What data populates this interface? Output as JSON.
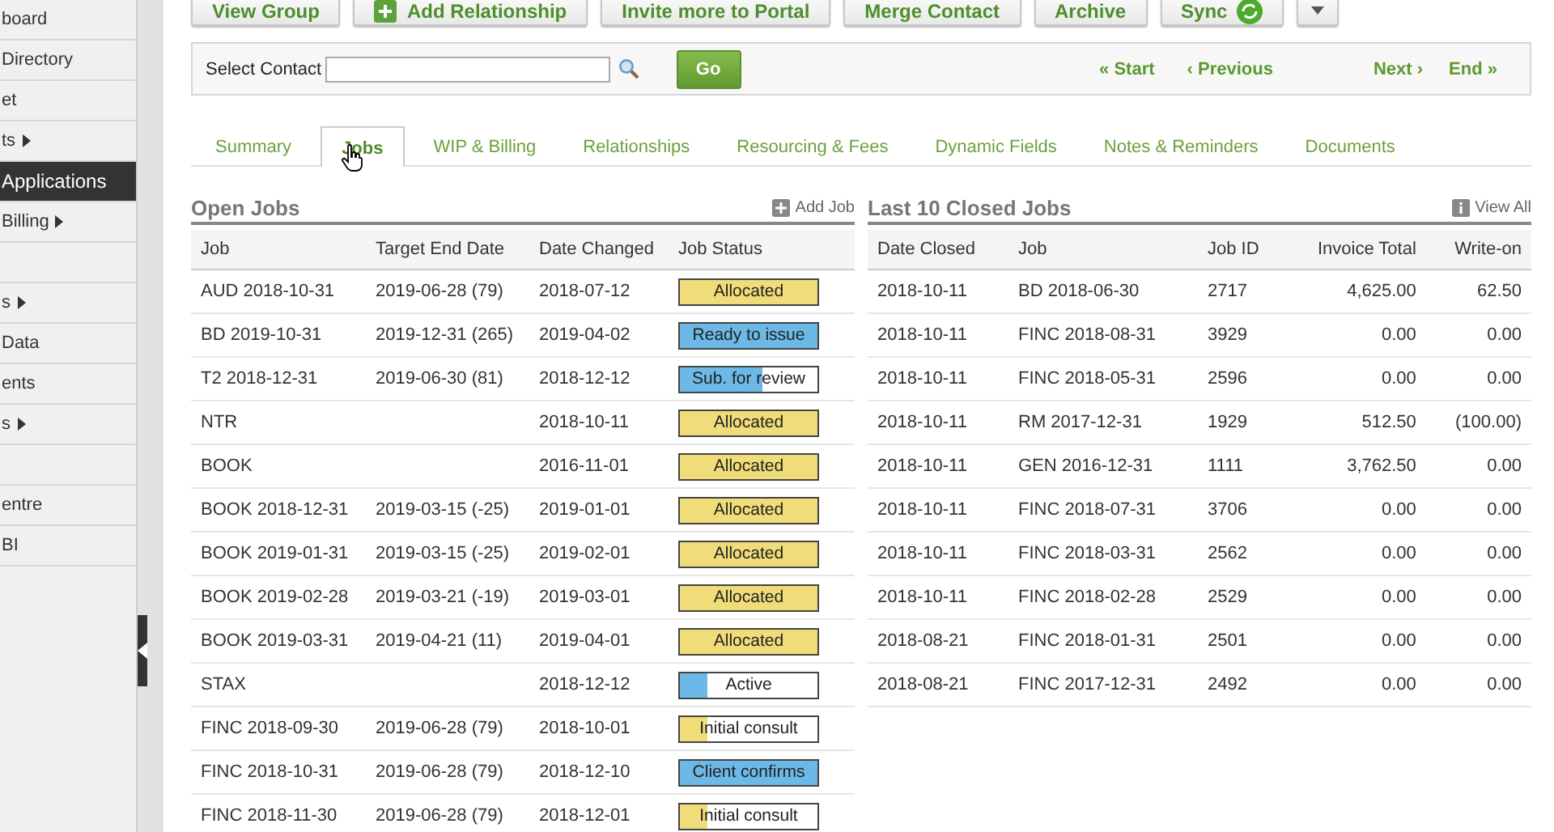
{
  "sidebar": {
    "items": [
      {
        "kind": "link",
        "label": "board",
        "selected": false,
        "submenu": false
      },
      {
        "kind": "link",
        "label": "Directory",
        "selected": false,
        "submenu": false
      },
      {
        "kind": "link",
        "label": "et",
        "selected": false,
        "submenu": false
      },
      {
        "kind": "link",
        "label": "ts",
        "selected": false,
        "submenu": true
      },
      {
        "kind": "link",
        "label": "Applications",
        "selected": true,
        "submenu": false
      },
      {
        "kind": "link",
        "label": "Billing",
        "selected": false,
        "submenu": true
      },
      {
        "kind": "blank"
      },
      {
        "kind": "link",
        "label": "s",
        "selected": false,
        "submenu": true
      },
      {
        "kind": "link",
        "label": "Data",
        "selected": false,
        "submenu": false
      },
      {
        "kind": "link",
        "label": "ents",
        "selected": false,
        "submenu": false
      },
      {
        "kind": "link",
        "label": "s",
        "selected": false,
        "submenu": true
      },
      {
        "kind": "blank"
      },
      {
        "kind": "link",
        "label": "entre",
        "selected": false,
        "submenu": false
      },
      {
        "kind": "link",
        "label": "BI",
        "selected": false,
        "submenu": false
      }
    ]
  },
  "toolbar": [
    {
      "kind": "plain",
      "label": "View Group"
    },
    {
      "kind": "add",
      "label": "Add Relationship"
    },
    {
      "kind": "plain",
      "label": "Invite more to Portal"
    },
    {
      "kind": "plain",
      "label": "Merge Contact"
    },
    {
      "kind": "plain",
      "label": "Archive"
    },
    {
      "kind": "sync",
      "label": "Sync"
    },
    {
      "kind": "menu"
    }
  ],
  "contact_bar": {
    "label": "Select Contact",
    "go": "Go",
    "nav": [
      "« Start",
      "‹ Previous",
      "Next ›",
      "End »"
    ]
  },
  "tabs": [
    {
      "label": "Summary",
      "selected": false
    },
    {
      "label": "Jobs",
      "selected": true
    },
    {
      "label": "WIP & Billing",
      "selected": false
    },
    {
      "label": "Relationships",
      "selected": false
    },
    {
      "label": "Resourcing & Fees",
      "selected": false
    },
    {
      "label": "Dynamic Fields",
      "selected": false
    },
    {
      "label": "Notes & Reminders",
      "selected": false
    },
    {
      "label": "Documents",
      "selected": false
    }
  ],
  "open_jobs": {
    "title": "Open Jobs",
    "action": "Add Job",
    "columns": [
      "Job",
      "Target End Date",
      "Date Changed",
      "Job Status"
    ],
    "rows": [
      {
        "job": "AUD 2018-10-31",
        "target": "2019-06-28 (79)",
        "changed": "2018-07-12",
        "status": {
          "label": "Allocated",
          "color": "#f0dc78",
          "level": 1
        }
      },
      {
        "job": "BD 2019-10-31",
        "target": "2019-12-31 (265)",
        "changed": "2019-04-02",
        "status": {
          "label": "Ready to issue",
          "color": "#6cb8e6",
          "level": 1
        }
      },
      {
        "job": "T2 2018-12-31",
        "target": "2019-06-30 (81)",
        "changed": "2018-12-12",
        "status": {
          "label": "Sub. for review",
          "color": "#6cb8e6",
          "level": 0.6
        }
      },
      {
        "job": "NTR",
        "changed": "2018-10-11",
        "status": {
          "label": "Allocated",
          "color": "#f0dc78",
          "level": 1
        }
      },
      {
        "job": "BOOK",
        "changed": "2016-11-01",
        "status": {
          "label": "Allocated",
          "color": "#f0dc78",
          "level": 1
        }
      },
      {
        "job": "BOOK 2018-12-31",
        "target": "2019-03-15 (-25)",
        "changed": "2019-01-01",
        "status": {
          "label": "Allocated",
          "color": "#f0dc78",
          "level": 1
        }
      },
      {
        "job": "BOOK 2019-01-31",
        "target": "2019-03-15 (-25)",
        "changed": "2019-02-01",
        "status": {
          "label": "Allocated",
          "color": "#f0dc78",
          "level": 1
        }
      },
      {
        "job": "BOOK 2019-02-28",
        "target": "2019-03-21 (-19)",
        "changed": "2019-03-01",
        "status": {
          "label": "Allocated",
          "color": "#f0dc78",
          "level": 1
        }
      },
      {
        "job": "BOOK 2019-03-31",
        "target": "2019-04-21 (11)",
        "changed": "2019-04-01",
        "status": {
          "label": "Allocated",
          "color": "#f0dc78",
          "level": 1
        }
      },
      {
        "job": "STAX",
        "changed": "2018-12-12",
        "status": {
          "label": "Active",
          "color": "#6cb8e6",
          "level": 0.2
        }
      },
      {
        "job": "FINC 2018-09-30",
        "target": "2019-06-28 (79)",
        "changed": "2018-10-01",
        "status": {
          "label": "Initial consult",
          "color": "#f0dc78",
          "level": 0.2
        }
      },
      {
        "job": "FINC 2018-10-31",
        "target": "2019-06-28 (79)",
        "changed": "2018-12-10",
        "status": {
          "label": "Client confirms",
          "color": "#6cb8e6",
          "level": 1
        }
      },
      {
        "job": "FINC 2018-11-30",
        "target": "2019-06-28 (79)",
        "changed": "2018-12-01",
        "status": {
          "label": "Initial consult",
          "color": "#f0dc78",
          "level": 0.2
        }
      }
    ]
  },
  "closed_jobs": {
    "title": "Last 10 Closed Jobs",
    "action": "View All",
    "columns": [
      "Date Closed",
      "Job",
      "Job ID",
      "Invoice Total",
      "Write-on"
    ],
    "rows": [
      [
        "2018-10-11",
        "BD 2018-06-30",
        "2717",
        "4,625.00",
        "62.50"
      ],
      [
        "2018-10-11",
        "FINC 2018-08-31",
        "3929",
        "0.00",
        "0.00"
      ],
      [
        "2018-10-11",
        "FINC 2018-05-31",
        "2596",
        "0.00",
        "0.00"
      ],
      [
        "2018-10-11",
        "RM 2017-12-31",
        "1929",
        "512.50",
        "(100.00)"
      ],
      [
        "2018-10-11",
        "GEN 2016-12-31",
        "1111",
        "3,762.50",
        "0.00"
      ],
      [
        "2018-10-11",
        "FINC 2018-07-31",
        "3706",
        "0.00",
        "0.00"
      ],
      [
        "2018-10-11",
        "FINC 2018-03-31",
        "2562",
        "0.00",
        "0.00"
      ],
      [
        "2018-10-11",
        "FINC 2018-02-28",
        "2529",
        "0.00",
        "0.00"
      ],
      [
        "2018-08-21",
        "FINC 2018-01-31",
        "2501",
        "0.00",
        "0.00"
      ],
      [
        "2018-08-21",
        "FINC 2017-12-31",
        "2492",
        "0.00",
        "0.00"
      ]
    ]
  }
}
